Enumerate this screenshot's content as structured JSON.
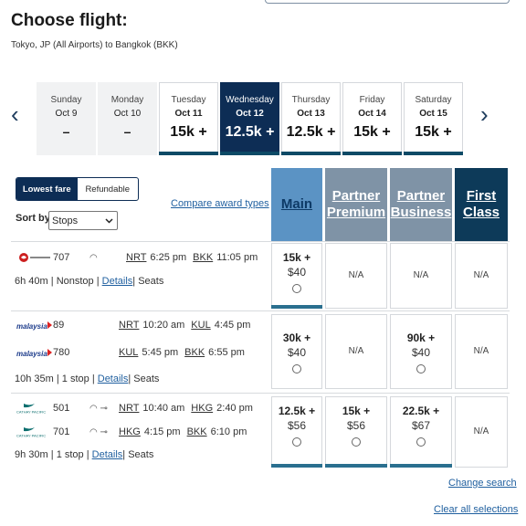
{
  "page": {
    "title": "Choose flight:",
    "route": "Tokyo, JP (All Airports) to Bangkok (BKK)"
  },
  "dates": [
    {
      "dow": "Sunday",
      "date": "Oct 9",
      "price": "–",
      "state": "disabled"
    },
    {
      "dow": "Monday",
      "date": "Oct 10",
      "price": "–",
      "state": "disabled"
    },
    {
      "dow": "Tuesday",
      "date": "Oct 11",
      "price": "15k +",
      "state": "normal"
    },
    {
      "dow": "Wednesday",
      "date": "Oct 12",
      "price": "12.5k +",
      "state": "selected"
    },
    {
      "dow": "Thursday",
      "date": "Oct 13",
      "price": "12.5k +",
      "state": "normal"
    },
    {
      "dow": "Friday",
      "date": "Oct 14",
      "price": "15k +",
      "state": "normal"
    },
    {
      "dow": "Saturday",
      "date": "Oct 15",
      "price": "15k +",
      "state": "normal"
    }
  ],
  "controls": {
    "toggle_lowest": "Lowest fare",
    "toggle_refundable": "Refundable",
    "sort_label": "Sort by",
    "sort_value": "Stops",
    "compare_link": "Compare award types"
  },
  "cabins": {
    "main": "Main",
    "partner_premium_1": "Partner",
    "partner_premium_2": "Premium",
    "partner_business_1": "Partner",
    "partner_business_2": "Business",
    "first_1": "First",
    "first_2": "Class"
  },
  "flights": [
    {
      "segments": [
        {
          "airline": "JAL",
          "number": "707",
          "from": "NRT",
          "dep": "6:25 pm",
          "to": "BKK",
          "arr": "11:05 pm"
        }
      ],
      "duration": "6h 40m",
      "stops": "Nonstop",
      "details": "Details",
      "seats": "Seats",
      "fares": [
        {
          "pts": "15k +",
          "cash": "$40"
        },
        {
          "na": "N/A"
        },
        {
          "na": "N/A"
        },
        {
          "na": "N/A"
        }
      ]
    },
    {
      "segments": [
        {
          "airline": "malaysia",
          "number": "89",
          "from": "NRT",
          "dep": "10:20 am",
          "to": "KUL",
          "arr": "4:45 pm"
        },
        {
          "airline": "malaysia",
          "number": "780",
          "from": "KUL",
          "dep": "5:45 pm",
          "to": "BKK",
          "arr": "6:55 pm"
        }
      ],
      "duration": "10h 35m",
      "stops": "1 stop",
      "details": "Details",
      "seats": "Seats",
      "fares": [
        {
          "pts": "30k +",
          "cash": "$40"
        },
        {
          "na": "N/A"
        },
        {
          "pts": "90k +",
          "cash": "$40"
        },
        {
          "na": "N/A"
        }
      ]
    },
    {
      "segments": [
        {
          "airline": "CATHAY PACIFIC",
          "number": "501",
          "from": "NRT",
          "dep": "10:40 am",
          "to": "HKG",
          "arr": "2:40 pm"
        },
        {
          "airline": "CATHAY PACIFIC",
          "number": "701",
          "from": "HKG",
          "dep": "4:15 pm",
          "to": "BKK",
          "arr": "6:10 pm"
        }
      ],
      "duration": "9h 30m",
      "stops": "1 stop",
      "details": "Details",
      "seats": "Seats",
      "fares": [
        {
          "pts": "12.5k +",
          "cash": "$56"
        },
        {
          "pts": "15k +",
          "cash": "$56"
        },
        {
          "pts": "22.5k +",
          "cash": "$67"
        },
        {
          "na": "N/A"
        }
      ]
    }
  ],
  "footer": {
    "change_search": "Change search",
    "clear_all": "Clear all selections"
  },
  "colors": {
    "navy": "#0d2d55",
    "main_cabin": "#5b93c4",
    "partner_cabin": "#7f93a6",
    "first_cabin": "#0d3a59",
    "link": "#1f5f9f"
  }
}
